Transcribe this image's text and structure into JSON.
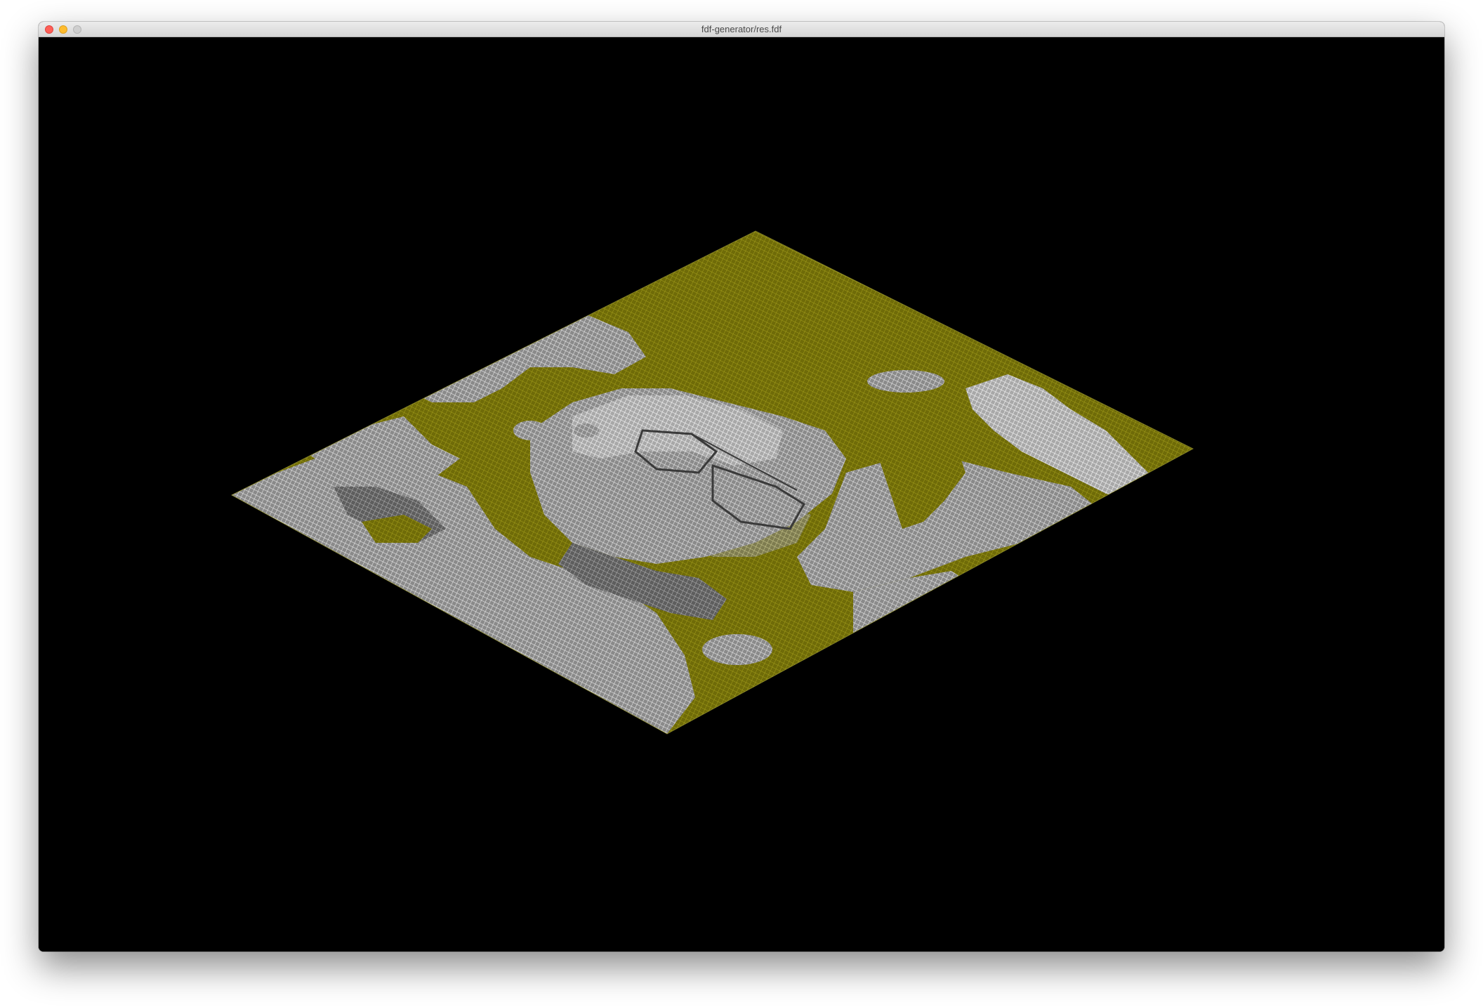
{
  "window": {
    "title": "fdf-generator/res.fdf",
    "controls": [
      {
        "name": "close-button",
        "color": "#fe5f57",
        "border": "#e0443e"
      },
      {
        "name": "minimize-button",
        "color": "#febc2e",
        "border": "#dea123"
      },
      {
        "name": "zoom-button",
        "color": "#cfcfcf",
        "border": "#b5b5b5"
      }
    ]
  },
  "viewport": {
    "background": "#000000"
  },
  "wireframe": {
    "projection": "isometric",
    "colors": {
      "low": "#7e7a0a",
      "high": "#c9c9c9",
      "highlight": "#f0f0f0",
      "shadow": "#8f8f8f"
    }
  }
}
